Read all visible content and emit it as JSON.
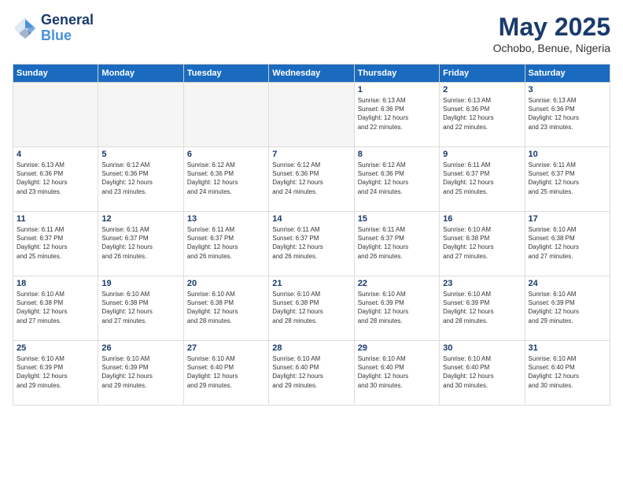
{
  "header": {
    "logo_line1": "General",
    "logo_line2": "Blue",
    "month": "May 2025",
    "location": "Ochobo, Benue, Nigeria"
  },
  "days_of_week": [
    "Sunday",
    "Monday",
    "Tuesday",
    "Wednesday",
    "Thursday",
    "Friday",
    "Saturday"
  ],
  "weeks": [
    [
      {
        "day": "",
        "info": "",
        "empty": true
      },
      {
        "day": "",
        "info": "",
        "empty": true
      },
      {
        "day": "",
        "info": "",
        "empty": true
      },
      {
        "day": "",
        "info": "",
        "empty": true
      },
      {
        "day": "1",
        "info": "Sunrise: 6:13 AM\nSunset: 6:36 PM\nDaylight: 12 hours\nand 22 minutes.",
        "empty": false
      },
      {
        "day": "2",
        "info": "Sunrise: 6:13 AM\nSunset: 6:36 PM\nDaylight: 12 hours\nand 22 minutes.",
        "empty": false
      },
      {
        "day": "3",
        "info": "Sunrise: 6:13 AM\nSunset: 6:36 PM\nDaylight: 12 hours\nand 23 minutes.",
        "empty": false
      }
    ],
    [
      {
        "day": "4",
        "info": "Sunrise: 6:13 AM\nSunset: 6:36 PM\nDaylight: 12 hours\nand 23 minutes.",
        "empty": false
      },
      {
        "day": "5",
        "info": "Sunrise: 6:12 AM\nSunset: 6:36 PM\nDaylight: 12 hours\nand 23 minutes.",
        "empty": false
      },
      {
        "day": "6",
        "info": "Sunrise: 6:12 AM\nSunset: 6:36 PM\nDaylight: 12 hours\nand 24 minutes.",
        "empty": false
      },
      {
        "day": "7",
        "info": "Sunrise: 6:12 AM\nSunset: 6:36 PM\nDaylight: 12 hours\nand 24 minutes.",
        "empty": false
      },
      {
        "day": "8",
        "info": "Sunrise: 6:12 AM\nSunset: 6:36 PM\nDaylight: 12 hours\nand 24 minutes.",
        "empty": false
      },
      {
        "day": "9",
        "info": "Sunrise: 6:11 AM\nSunset: 6:37 PM\nDaylight: 12 hours\nand 25 minutes.",
        "empty": false
      },
      {
        "day": "10",
        "info": "Sunrise: 6:11 AM\nSunset: 6:37 PM\nDaylight: 12 hours\nand 25 minutes.",
        "empty": false
      }
    ],
    [
      {
        "day": "11",
        "info": "Sunrise: 6:11 AM\nSunset: 6:37 PM\nDaylight: 12 hours\nand 25 minutes.",
        "empty": false
      },
      {
        "day": "12",
        "info": "Sunrise: 6:11 AM\nSunset: 6:37 PM\nDaylight: 12 hours\nand 26 minutes.",
        "empty": false
      },
      {
        "day": "13",
        "info": "Sunrise: 6:11 AM\nSunset: 6:37 PM\nDaylight: 12 hours\nand 26 minutes.",
        "empty": false
      },
      {
        "day": "14",
        "info": "Sunrise: 6:11 AM\nSunset: 6:37 PM\nDaylight: 12 hours\nand 26 minutes.",
        "empty": false
      },
      {
        "day": "15",
        "info": "Sunrise: 6:11 AM\nSunset: 6:37 PM\nDaylight: 12 hours\nand 26 minutes.",
        "empty": false
      },
      {
        "day": "16",
        "info": "Sunrise: 6:10 AM\nSunset: 6:38 PM\nDaylight: 12 hours\nand 27 minutes.",
        "empty": false
      },
      {
        "day": "17",
        "info": "Sunrise: 6:10 AM\nSunset: 6:38 PM\nDaylight: 12 hours\nand 27 minutes.",
        "empty": false
      }
    ],
    [
      {
        "day": "18",
        "info": "Sunrise: 6:10 AM\nSunset: 6:38 PM\nDaylight: 12 hours\nand 27 minutes.",
        "empty": false
      },
      {
        "day": "19",
        "info": "Sunrise: 6:10 AM\nSunset: 6:38 PM\nDaylight: 12 hours\nand 27 minutes.",
        "empty": false
      },
      {
        "day": "20",
        "info": "Sunrise: 6:10 AM\nSunset: 6:38 PM\nDaylight: 12 hours\nand 28 minutes.",
        "empty": false
      },
      {
        "day": "21",
        "info": "Sunrise: 6:10 AM\nSunset: 6:38 PM\nDaylight: 12 hours\nand 28 minutes.",
        "empty": false
      },
      {
        "day": "22",
        "info": "Sunrise: 6:10 AM\nSunset: 6:39 PM\nDaylight: 12 hours\nand 28 minutes.",
        "empty": false
      },
      {
        "day": "23",
        "info": "Sunrise: 6:10 AM\nSunset: 6:39 PM\nDaylight: 12 hours\nand 28 minutes.",
        "empty": false
      },
      {
        "day": "24",
        "info": "Sunrise: 6:10 AM\nSunset: 6:39 PM\nDaylight: 12 hours\nand 29 minutes.",
        "empty": false
      }
    ],
    [
      {
        "day": "25",
        "info": "Sunrise: 6:10 AM\nSunset: 6:39 PM\nDaylight: 12 hours\nand 29 minutes.",
        "empty": false
      },
      {
        "day": "26",
        "info": "Sunrise: 6:10 AM\nSunset: 6:39 PM\nDaylight: 12 hours\nand 29 minutes.",
        "empty": false
      },
      {
        "day": "27",
        "info": "Sunrise: 6:10 AM\nSunset: 6:40 PM\nDaylight: 12 hours\nand 29 minutes.",
        "empty": false
      },
      {
        "day": "28",
        "info": "Sunrise: 6:10 AM\nSunset: 6:40 PM\nDaylight: 12 hours\nand 29 minutes.",
        "empty": false
      },
      {
        "day": "29",
        "info": "Sunrise: 6:10 AM\nSunset: 6:40 PM\nDaylight: 12 hours\nand 30 minutes.",
        "empty": false
      },
      {
        "day": "30",
        "info": "Sunrise: 6:10 AM\nSunset: 6:40 PM\nDaylight: 12 hours\nand 30 minutes.",
        "empty": false
      },
      {
        "day": "31",
        "info": "Sunrise: 6:10 AM\nSunset: 6:40 PM\nDaylight: 12 hours\nand 30 minutes.",
        "empty": false
      }
    ]
  ]
}
